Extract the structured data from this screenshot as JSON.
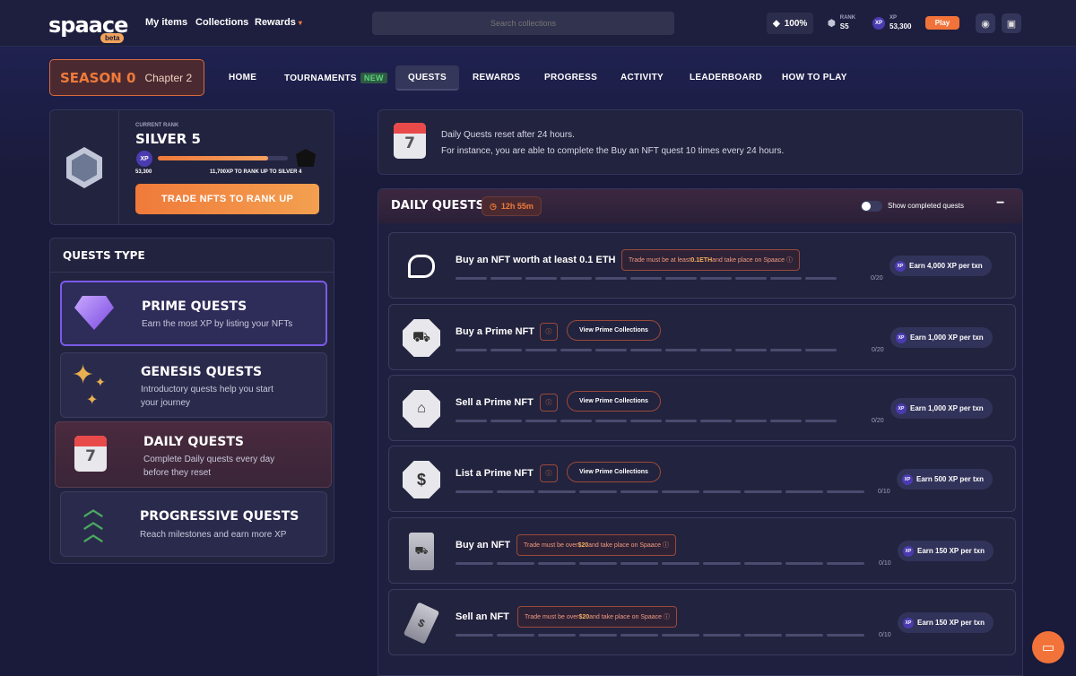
{
  "topbar": {
    "logo": "spaace",
    "beta": "beta",
    "nav": [
      "My items",
      "Collections",
      "Rewards"
    ],
    "search_placeholder": "Search collections",
    "zoom": "100%",
    "rank_label": "RANK",
    "rank_value": "S5",
    "xp_label": "XP",
    "xp_value": "53,300",
    "play": "Play",
    "xp_icon": "XP"
  },
  "season": {
    "label": "SEASON 0",
    "chapter": "Chapter 2"
  },
  "tabs": [
    "HOME",
    "TOURNAMENTS",
    "QUESTS",
    "REWARDS",
    "PROGRESS",
    "ACTIVITY",
    "LEADERBOARD",
    "HOW TO PLAY"
  ],
  "new_badge": "NEW",
  "active_tab": "QUESTS",
  "rank": {
    "label": "CURRENT RANK",
    "value": "SILVER 5",
    "xp": "53,300",
    "progress": 0.85,
    "to_next": "11,700XP TO RANK UP TO SILVER 4",
    "button": "TRADE NFTS TO RANK UP"
  },
  "quest_types": {
    "heading": "QUESTS TYPE",
    "items": [
      {
        "title": "PRIME QUESTS",
        "desc": "Earn the most XP by listing your NFTs"
      },
      {
        "title": "GENESIS QUESTS",
        "desc": "Introductory quests help you start your journey"
      },
      {
        "title": "DAILY QUESTS",
        "desc": "Complete Daily quests every day before they reset"
      },
      {
        "title": "PROGRESSIVE QUESTS",
        "desc": "Reach milestones and earn more XP"
      }
    ]
  },
  "calendar_day": "7",
  "info": {
    "line1": "Daily Quests reset after 24 hours.",
    "line2": "For instance, you are able to complete the Buy an NFT quest 10 times every 24 hours."
  },
  "daily": {
    "title": "DAILY QUESTS",
    "timer": "12h 55m",
    "toggle_label": "Show completed quests",
    "collapse": "−",
    "quests": [
      {
        "name": "Buy an NFT worth at least 0.1 ETH",
        "cond_pre": "Trade must be at least ",
        "cond_val": "0.1ETH",
        "cond_post": " and take place on Spaace",
        "count": "0/20",
        "earn": "Earn 4,000 XP per txn"
      },
      {
        "name": "Buy a Prime NFT",
        "button": "View Prime Collections",
        "count": "0/20",
        "earn": "Earn 1,000 XP per txn"
      },
      {
        "name": "Sell a Prime NFT",
        "button": "View Prime Collections",
        "count": "0/20",
        "earn": "Earn 1,000 XP per txn"
      },
      {
        "name": "List a Prime NFT",
        "button": "View Prime Collections",
        "count": "0/10",
        "earn": "Earn 500 XP per txn"
      },
      {
        "name": "Buy an NFT",
        "cond_pre": "Trade must be over ",
        "cond_val": "$20",
        "cond_post": " and take place on Spaace",
        "count": "0/10",
        "earn": "Earn 150 XP per txn"
      },
      {
        "name": "Sell an NFT",
        "cond_pre": "Trade must be over ",
        "cond_val": "$20",
        "cond_post": " and take place on Spaace",
        "count": "0/10",
        "earn": "Earn 150 XP per txn"
      }
    ]
  }
}
